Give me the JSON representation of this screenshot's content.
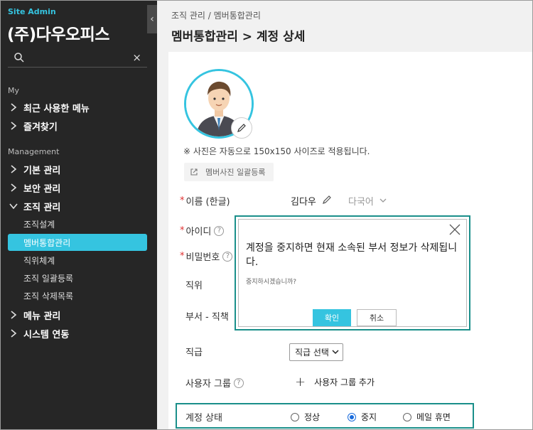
{
  "sidebar": {
    "brand": "Site Admin",
    "company": "(주)다우오피스",
    "search": {
      "value": "",
      "clear": "×"
    },
    "toggle": "‹",
    "sections": [
      {
        "title": "My"
      },
      {
        "title": "Management"
      }
    ],
    "items": {
      "recent": "최근 사용한 메뉴",
      "favorites": "즐겨찾기",
      "basic": "기본 관리",
      "security": "보안 관리",
      "org": "조직 관리",
      "org_design": "조직설계",
      "member": "멤버통합관리",
      "position": "직위체계",
      "org_bulk": "조직 일괄등록",
      "org_deleted": "조직 삭제목록",
      "menu": "메뉴 관리",
      "system": "시스템 연동"
    }
  },
  "header": {
    "breadcrumb": "조직 관리 / 멤버통합관리",
    "title": "멤버통합관리 > 계정 상세"
  },
  "profile": {
    "photo_note": "※ 사진은 자동으로 150x150 사이즈로 적용됩니다.",
    "bulk_photo": "멤버사진 일괄등록"
  },
  "form": {
    "name_label": "이름 (한글)",
    "name_value": "김다우",
    "lang": "다국어",
    "id_label": "아이디",
    "password_label": "비밀번호",
    "position_label": "직위",
    "dept_label": "부서 - 직책",
    "grade_label": "직급",
    "grade_select": "직급 선택",
    "group_label": "사용자 그룹",
    "group_add": "사용자 그룹 추가",
    "status_label": "계정 상태",
    "status_options": [
      "정상",
      "중지",
      "메일 휴면"
    ],
    "status_selected": "중지",
    "required_mark": "*",
    "help_mark": "?"
  },
  "modal": {
    "message": "계정을 중지하면 현재 소속된 부서 정보가 삭제됩니다.",
    "sub": "중지하시겠습니까?",
    "confirm": "확인",
    "cancel": "취소"
  },
  "colors": {
    "accent": "#35c4e0",
    "highlight_border": "#1a8f8a",
    "sidebar_bg": "#262626"
  }
}
